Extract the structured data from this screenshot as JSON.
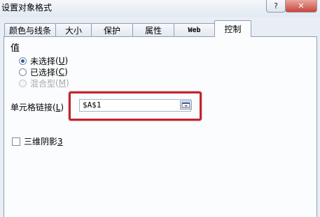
{
  "dialog": {
    "title": "设置对象格式",
    "help_label": "?",
    "close_label": "✕"
  },
  "tabs": [
    {
      "label": "颜色与线条"
    },
    {
      "label": "大小"
    },
    {
      "label": "保护"
    },
    {
      "label": "属性"
    },
    {
      "label": "Web"
    },
    {
      "label": "控制",
      "active": true
    }
  ],
  "value_group": {
    "label": "值",
    "options": [
      {
        "label": "未选择",
        "hotkey": "U",
        "checked": true,
        "enabled": true
      },
      {
        "label": "已选择",
        "hotkey": "C",
        "checked": false,
        "enabled": true
      },
      {
        "label": "混合型",
        "hotkey": "M",
        "checked": false,
        "enabled": false
      }
    ]
  },
  "cell_link": {
    "label": "单元格链接",
    "hotkey": "L",
    "value": "$A$1"
  },
  "shading": {
    "label": "三维阴影",
    "hotkey": "3",
    "checked": false
  },
  "colors": {
    "highlight": "#c0242c",
    "panel": "#fbfcfd",
    "background": "#e9eef5"
  },
  "icons": {
    "close": "close-icon",
    "collapse": "collapse-dialog-icon"
  }
}
